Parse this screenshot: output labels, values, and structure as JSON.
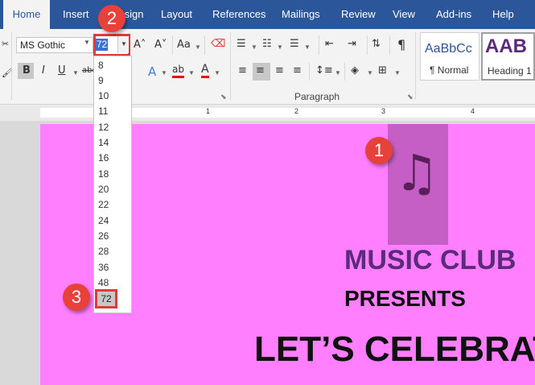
{
  "tabs": [
    "Home",
    "Insert",
    "Design",
    "Layout",
    "References",
    "Mailings",
    "Review",
    "View",
    "Add-ins",
    "Help"
  ],
  "font": {
    "name": "MS Gothic",
    "size": "72",
    "size_options": [
      "8",
      "9",
      "10",
      "11",
      "12",
      "14",
      "16",
      "18",
      "20",
      "22",
      "24",
      "26",
      "28",
      "36",
      "48",
      "72"
    ]
  },
  "ribbon": {
    "grow_font": "A˄",
    "shrink_font": "A˅",
    "change_case": "Aa",
    "bold": "B",
    "italic": "I",
    "underline": "U",
    "strikethrough": "abc",
    "text_effects": "A",
    "highlight": "ab",
    "font_color": "A",
    "show_hide": "¶",
    "paragraph_group": "Paragraph"
  },
  "styles": [
    {
      "sample": "AaBbCc",
      "name": "¶ Normal"
    },
    {
      "sample": "AAB",
      "name": "Heading 1"
    }
  ],
  "ruler": [
    "1",
    "2",
    "3",
    "4"
  ],
  "document": {
    "icon": "♫",
    "line1": "MUSIC CLUB",
    "line2": "PRESENTS",
    "line3": "LET’S CELEBRAT"
  },
  "callouts": [
    "1",
    "2",
    "3"
  ],
  "colors": {
    "accent": "#2b579a",
    "page": "#ff7fff",
    "callout": "#e8403a",
    "highlight": "#c55fc5"
  }
}
